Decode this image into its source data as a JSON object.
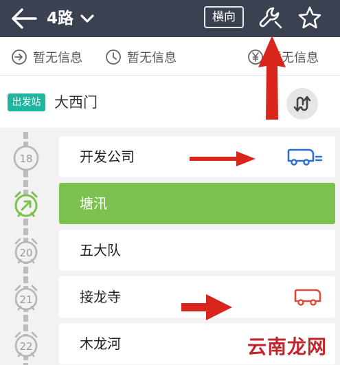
{
  "header": {
    "title": "4路",
    "landscape_label": "横向"
  },
  "info": [
    {
      "icon": "direction-icon",
      "text": "暂无信息"
    },
    {
      "icon": "clock-icon",
      "text": "暂无信息"
    },
    {
      "icon": "fare-icon",
      "text": "暂无信息"
    }
  ],
  "start": {
    "badge": "出发站",
    "name": "大西门"
  },
  "stops": [
    {
      "number": "18",
      "name": "开发公司",
      "bus": "arriving",
      "bus_color": "#2a6fd6"
    },
    {
      "number": "",
      "name": "塘汛",
      "active": true,
      "marker_color": "#7cc14f"
    },
    {
      "number": "20",
      "name": "五大队"
    },
    {
      "number": "21",
      "name": "接龙寺",
      "bus": "at-stop",
      "bus_color": "#e04a3a"
    },
    {
      "number": "22",
      "name": "木龙河"
    }
  ],
  "colors": {
    "header_bg": "#3a4150",
    "start_badge": "#1fb5a0",
    "active_stop": "#7cc14f",
    "annotation_red": "#d9261c"
  },
  "watermark": "云南龙网"
}
